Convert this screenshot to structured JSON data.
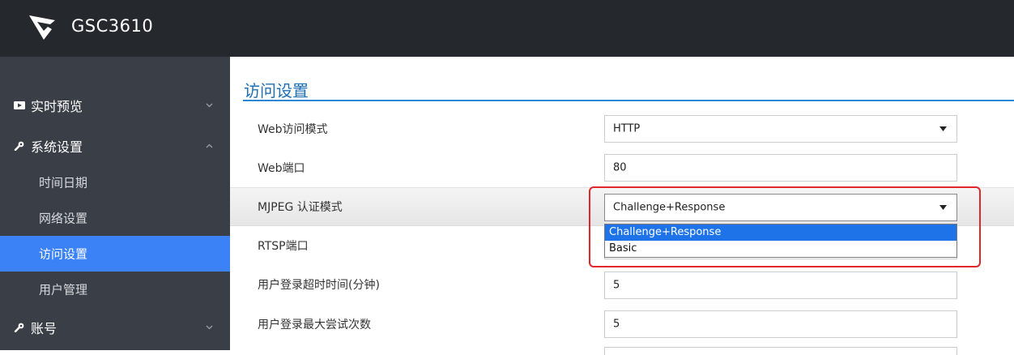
{
  "app": {
    "title": "GSC3610"
  },
  "sidebar": {
    "items": [
      {
        "label": "实时预览",
        "icon": "video-icon",
        "expanded": false
      },
      {
        "label": "系统设置",
        "icon": "wrench-icon",
        "expanded": true,
        "children": [
          {
            "label": "时间日期"
          },
          {
            "label": "网络设置"
          },
          {
            "label": "访问设置",
            "active": true
          },
          {
            "label": "用户管理"
          }
        ]
      },
      {
        "label": "账号",
        "icon": "wrench-icon",
        "expanded": false
      }
    ]
  },
  "main": {
    "section_title": "访问设置",
    "fields": [
      {
        "label": "Web访问模式",
        "type": "select",
        "value": "HTTP"
      },
      {
        "label": "Web端口",
        "type": "input",
        "value": "80"
      },
      {
        "label": "MJPEG 认证模式",
        "type": "select",
        "value": "Challenge+Response",
        "open": true,
        "options": [
          "Challenge+Response",
          "Basic"
        ],
        "selected_option": "Challenge+Response"
      },
      {
        "label": "RTSP端口",
        "type": "input",
        "value": ""
      },
      {
        "label": "用户登录超时时间(分钟)",
        "type": "input",
        "value": "5"
      },
      {
        "label": "用户登录最大尝试次数",
        "type": "input",
        "value": "5"
      }
    ]
  },
  "colors": {
    "topbar": "#25282d",
    "sidebar": "#3a3f47",
    "active_item": "#3b82f6",
    "title_accent": "#1f6fb6",
    "highlight_box": "#e2262a",
    "option_selected": "#1e73e8"
  }
}
